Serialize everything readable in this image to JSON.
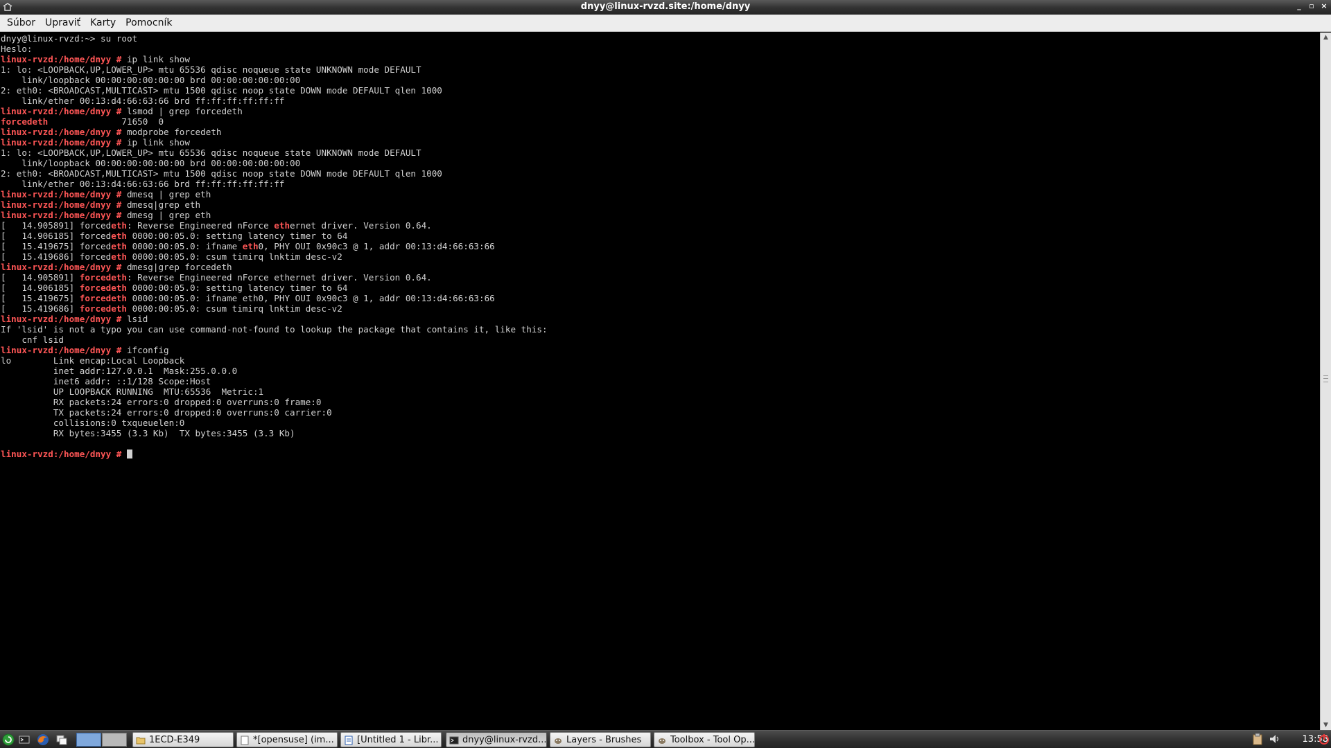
{
  "window": {
    "title": "dnyy@linux-rvzd.site:/home/dnyy",
    "controls": [
      "_",
      "▫",
      "×"
    ]
  },
  "menu": [
    {
      "label": "Súbor"
    },
    {
      "label": "Upraviť"
    },
    {
      "label": "Karty"
    },
    {
      "label": "Pomocník"
    }
  ],
  "terminal": {
    "lines": [
      [
        {
          "t": "dnyy@linux-rvzd:~> su root",
          "s": "t"
        }
      ],
      [
        {
          "t": "Heslo:",
          "s": "t"
        }
      ],
      [
        {
          "t": "linux-rvzd:/home/dnyy #",
          "s": "p"
        },
        {
          "t": " ip link show",
          "s": "t"
        }
      ],
      [
        {
          "t": "1: lo: <LOOPBACK,UP,LOWER_UP> mtu 65536 qdisc noqueue state UNKNOWN mode DEFAULT",
          "s": "t"
        }
      ],
      [
        {
          "t": "    link/loopback 00:00:00:00:00:00 brd 00:00:00:00:00:00",
          "s": "t"
        }
      ],
      [
        {
          "t": "2: eth0: <BROADCAST,MULTICAST> mtu 1500 qdisc noop state DOWN mode DEFAULT qlen 1000",
          "s": "t"
        }
      ],
      [
        {
          "t": "    link/ether 00:13:d4:66:63:66 brd ff:ff:ff:ff:ff:ff",
          "s": "t"
        }
      ],
      [
        {
          "t": "linux-rvzd:/home/dnyy #",
          "s": "p"
        },
        {
          "t": " lsmod | grep forcedeth",
          "s": "t"
        }
      ],
      [
        {
          "t": "forcedeth",
          "s": "h"
        },
        {
          "t": "              71650  0",
          "s": "t"
        }
      ],
      [
        {
          "t": "linux-rvzd:/home/dnyy #",
          "s": "p"
        },
        {
          "t": " modprobe forcedeth",
          "s": "t"
        }
      ],
      [
        {
          "t": "linux-rvzd:/home/dnyy #",
          "s": "p"
        },
        {
          "t": " ip link show",
          "s": "t"
        }
      ],
      [
        {
          "t": "1: lo: <LOOPBACK,UP,LOWER_UP> mtu 65536 qdisc noqueue state UNKNOWN mode DEFAULT",
          "s": "t"
        }
      ],
      [
        {
          "t": "    link/loopback 00:00:00:00:00:00 brd 00:00:00:00:00:00",
          "s": "t"
        }
      ],
      [
        {
          "t": "2: eth0: <BROADCAST,MULTICAST> mtu 1500 qdisc noop state DOWN mode DEFAULT qlen 1000",
          "s": "t"
        }
      ],
      [
        {
          "t": "    link/ether 00:13:d4:66:63:66 brd ff:ff:ff:ff:ff:ff",
          "s": "t"
        }
      ],
      [
        {
          "t": "linux-rvzd:/home/dnyy #",
          "s": "p"
        },
        {
          "t": " dmesq | grep eth",
          "s": "t"
        }
      ],
      [
        {
          "t": "linux-rvzd:/home/dnyy #",
          "s": "p"
        },
        {
          "t": " dmesq|grep eth",
          "s": "t"
        }
      ],
      [
        {
          "t": "linux-rvzd:/home/dnyy #",
          "s": "p"
        },
        {
          "t": " dmesg | grep eth",
          "s": "t"
        }
      ],
      [
        {
          "t": "[   14.905891] forced",
          "s": "t"
        },
        {
          "t": "eth",
          "s": "h"
        },
        {
          "t": ": Reverse Engineered nForce ",
          "s": "t"
        },
        {
          "t": "eth",
          "s": "h"
        },
        {
          "t": "ernet driver. Version 0.64.",
          "s": "t"
        }
      ],
      [
        {
          "t": "[   14.906185] forced",
          "s": "t"
        },
        {
          "t": "eth",
          "s": "h"
        },
        {
          "t": " 0000:00:05.0: setting latency timer to 64",
          "s": "t"
        }
      ],
      [
        {
          "t": "[   15.419675] forced",
          "s": "t"
        },
        {
          "t": "eth",
          "s": "h"
        },
        {
          "t": " 0000:00:05.0: ifname ",
          "s": "t"
        },
        {
          "t": "eth",
          "s": "h"
        },
        {
          "t": "0, PHY OUI 0x90c3 @ 1, addr 00:13:d4:66:63:66",
          "s": "t"
        }
      ],
      [
        {
          "t": "[   15.419686] forced",
          "s": "t"
        },
        {
          "t": "eth",
          "s": "h"
        },
        {
          "t": " 0000:00:05.0: csum timirq lnktim desc-v2",
          "s": "t"
        }
      ],
      [
        {
          "t": "linux-rvzd:/home/dnyy #",
          "s": "p"
        },
        {
          "t": " dmesg|grep forcedeth",
          "s": "t"
        }
      ],
      [
        {
          "t": "[   14.905891] ",
          "s": "t"
        },
        {
          "t": "forcedeth",
          "s": "h"
        },
        {
          "t": ": Reverse Engineered nForce ethernet driver. Version 0.64.",
          "s": "t"
        }
      ],
      [
        {
          "t": "[   14.906185] ",
          "s": "t"
        },
        {
          "t": "forcedeth",
          "s": "h"
        },
        {
          "t": " 0000:00:05.0: setting latency timer to 64",
          "s": "t"
        }
      ],
      [
        {
          "t": "[   15.419675] ",
          "s": "t"
        },
        {
          "t": "forcedeth",
          "s": "h"
        },
        {
          "t": " 0000:00:05.0: ifname eth0, PHY OUI 0x90c3 @ 1, addr 00:13:d4:66:63:66",
          "s": "t"
        }
      ],
      [
        {
          "t": "[   15.419686] ",
          "s": "t"
        },
        {
          "t": "forcedeth",
          "s": "h"
        },
        {
          "t": " 0000:00:05.0: csum timirq lnktim desc-v2",
          "s": "t"
        }
      ],
      [
        {
          "t": "linux-rvzd:/home/dnyy #",
          "s": "p"
        },
        {
          "t": " lsid",
          "s": "t"
        }
      ],
      [
        {
          "t": "If 'lsid' is not a typo you can use command-not-found to lookup the package that contains it, like this:",
          "s": "t"
        }
      ],
      [
        {
          "t": "    cnf lsid",
          "s": "t"
        }
      ],
      [
        {
          "t": "linux-rvzd:/home/dnyy #",
          "s": "p"
        },
        {
          "t": " ifconfig",
          "s": "t"
        }
      ],
      [
        {
          "t": "lo        Link encap:Local Loopback",
          "s": "t"
        }
      ],
      [
        {
          "t": "          inet addr:127.0.0.1  Mask:255.0.0.0",
          "s": "t"
        }
      ],
      [
        {
          "t": "          inet6 addr: ::1/128 Scope:Host",
          "s": "t"
        }
      ],
      [
        {
          "t": "          UP LOOPBACK RUNNING  MTU:65536  Metric:1",
          "s": "t"
        }
      ],
      [
        {
          "t": "          RX packets:24 errors:0 dropped:0 overruns:0 frame:0",
          "s": "t"
        }
      ],
      [
        {
          "t": "          TX packets:24 errors:0 dropped:0 overruns:0 carrier:0",
          "s": "t"
        }
      ],
      [
        {
          "t": "          collisions:0 txqueuelen:0",
          "s": "t"
        }
      ],
      [
        {
          "t": "          RX bytes:3455 (3.3 Kb)  TX bytes:3455 (3.3 Kb)",
          "s": "t"
        }
      ],
      [],
      [
        {
          "t": "linux-rvzd:/home/dnyy #",
          "s": "p"
        },
        {
          "t": " ",
          "s": "t"
        }
      ]
    ],
    "colors": {
      "prompt": "#ff5656",
      "text": "#d2d2d2",
      "background": "#000000"
    }
  },
  "taskbar": {
    "launchers": [
      "system-icon",
      "terminal-icon",
      "firefox-icon",
      "file-manager-icon"
    ],
    "tasks": [
      {
        "label": "1ECD-E349",
        "icon": "folder-icon"
      },
      {
        "label": "*[opensuse] (im...",
        "icon": "image-icon"
      },
      {
        "label": "[Untitled 1 - Libr...",
        "icon": "document-icon"
      },
      {
        "label": "dnyy@linux-rvzd....",
        "icon": "terminal-icon",
        "active": true
      },
      {
        "label": "Layers - Brushes",
        "icon": "gimp-icon"
      },
      {
        "label": "Toolbox - Tool Op...",
        "icon": "gimp-icon"
      }
    ],
    "clock": "13:58"
  }
}
